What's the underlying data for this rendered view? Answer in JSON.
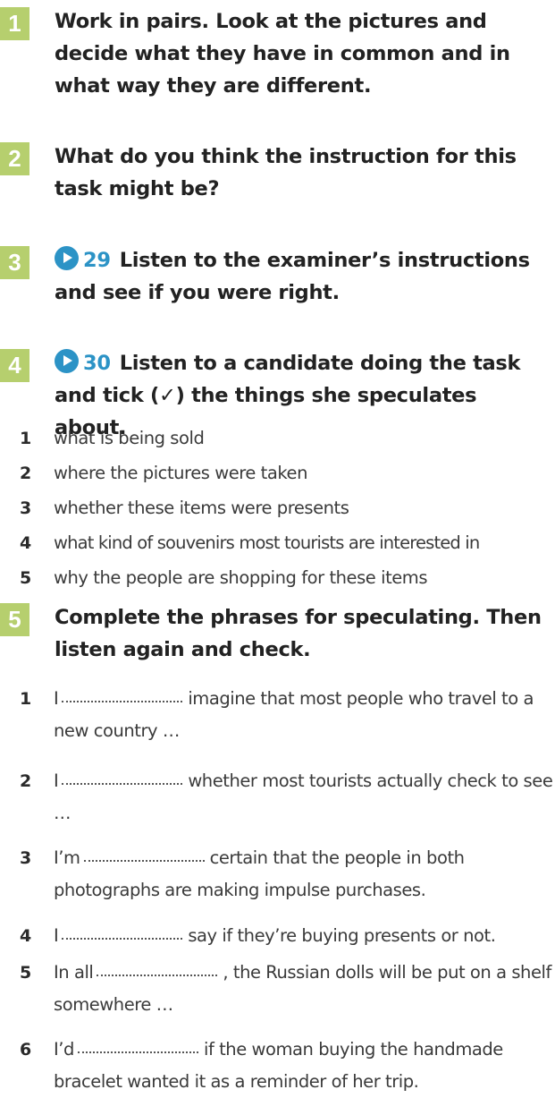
{
  "tasks": [
    {
      "number": "1",
      "title": "Work in pairs. Look at the pictures and decide what they have in common and in what way they are different."
    },
    {
      "number": "2",
      "title": "What do you think the instruction for this task might be?"
    },
    {
      "number": "3",
      "audio": "29",
      "title": "Listen to the examiner’s instructions and see if you were right."
    },
    {
      "number": "4",
      "audio": "30",
      "title": "Listen to a candidate doing the task and tick (✓) the things she speculates about."
    },
    {
      "number": "5",
      "title": "Complete the phrases for speculating. Then listen again and check."
    }
  ],
  "task4_items": [
    {
      "n": "1",
      "text": "what is being sold"
    },
    {
      "n": "2",
      "text": "where the pictures were taken"
    },
    {
      "n": "3",
      "text": "whether these items were presents"
    },
    {
      "n": "4",
      "text": "what kind of souvenirs most tourists are interested in"
    },
    {
      "n": "5",
      "text": "why the people are shopping for these items"
    }
  ],
  "task5_items": [
    {
      "n": "1",
      "before": "I",
      "after": "imagine that most people who travel to a new country …"
    },
    {
      "n": "2",
      "before": "I",
      "after": "whether most tourists actually check to see …"
    },
    {
      "n": "3",
      "before": "I’m",
      "after": "certain that the people in both photographs are making impulse purchases."
    },
    {
      "n": "4",
      "before": "I",
      "after": "say if they’re buying presents or not."
    },
    {
      "n": "5",
      "before": "In all",
      "after": ", the Russian dolls will be put on a shelf somewhere …"
    },
    {
      "n": "6",
      "before": "I’d",
      "after": "if the woman buying the handmade bracelet wanted it as a reminder of her trip."
    }
  ],
  "colors": {
    "badge": "#b6cf6e",
    "audio": "#2c93c6"
  },
  "icons": {
    "audio": "play-icon"
  }
}
